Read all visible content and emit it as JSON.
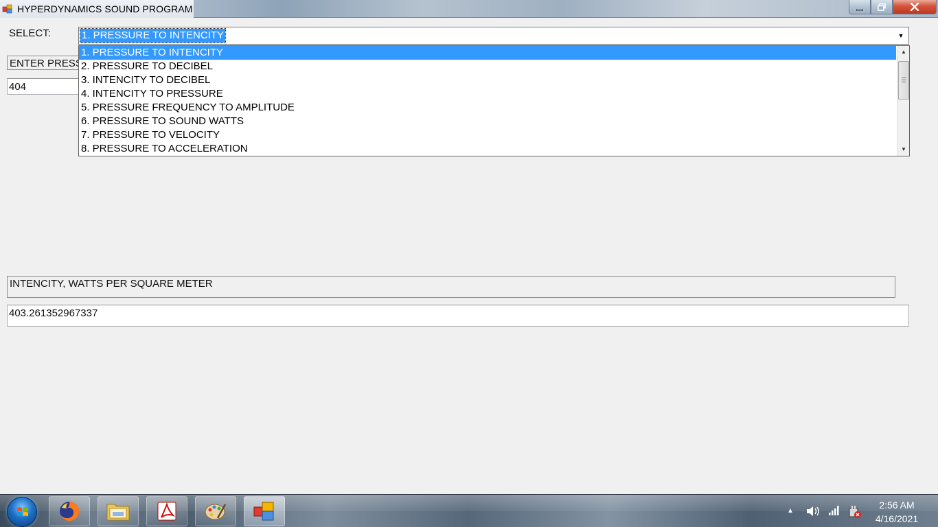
{
  "window": {
    "title": "HYPERDYNAMICS SOUND PROGRAM",
    "controls": {
      "minimize": "minimize",
      "maximize": "restore",
      "close": "close"
    }
  },
  "form": {
    "select_label": "SELECT:",
    "combo_value": "1. PRESSURE TO INTENCITY",
    "dropdown_options": [
      "1. PRESSURE TO INTENCITY",
      "2. PRESSURE TO DECIBEL",
      "3. INTENCITY TO DECIBEL",
      "4. INTENCITY TO PRESSURE",
      "5. PRESSURE FREQUENCY TO AMPLITUDE",
      "6. PRESSURE TO SOUND WATTS",
      "7. PRESSURE TO VELOCITY",
      "8. PRESSURE TO ACCELERATION"
    ],
    "selected_option_index": 0,
    "input_label": "ENTER PRESSURE",
    "input_value": "404",
    "output_label": "INTENCITY, WATTS PER SQUARE METER",
    "output_value": "403.261352967337"
  },
  "taskbar": {
    "start_icon": "windows-start-orb",
    "pinned": [
      "firefox-icon",
      "file-explorer-icon",
      "acrobat-reader-icon",
      "paint-icon",
      "hyperdynamics-app-icon"
    ],
    "tray_icons": [
      "show-hidden-icons-arrow",
      "volume-icon",
      "network-signal-icon",
      "power-icon"
    ],
    "clock_time": "2:56 AM",
    "clock_date": "4/16/2021"
  },
  "colors": {
    "selection": "#3399ff",
    "window_bg": "#f0f0f0"
  }
}
